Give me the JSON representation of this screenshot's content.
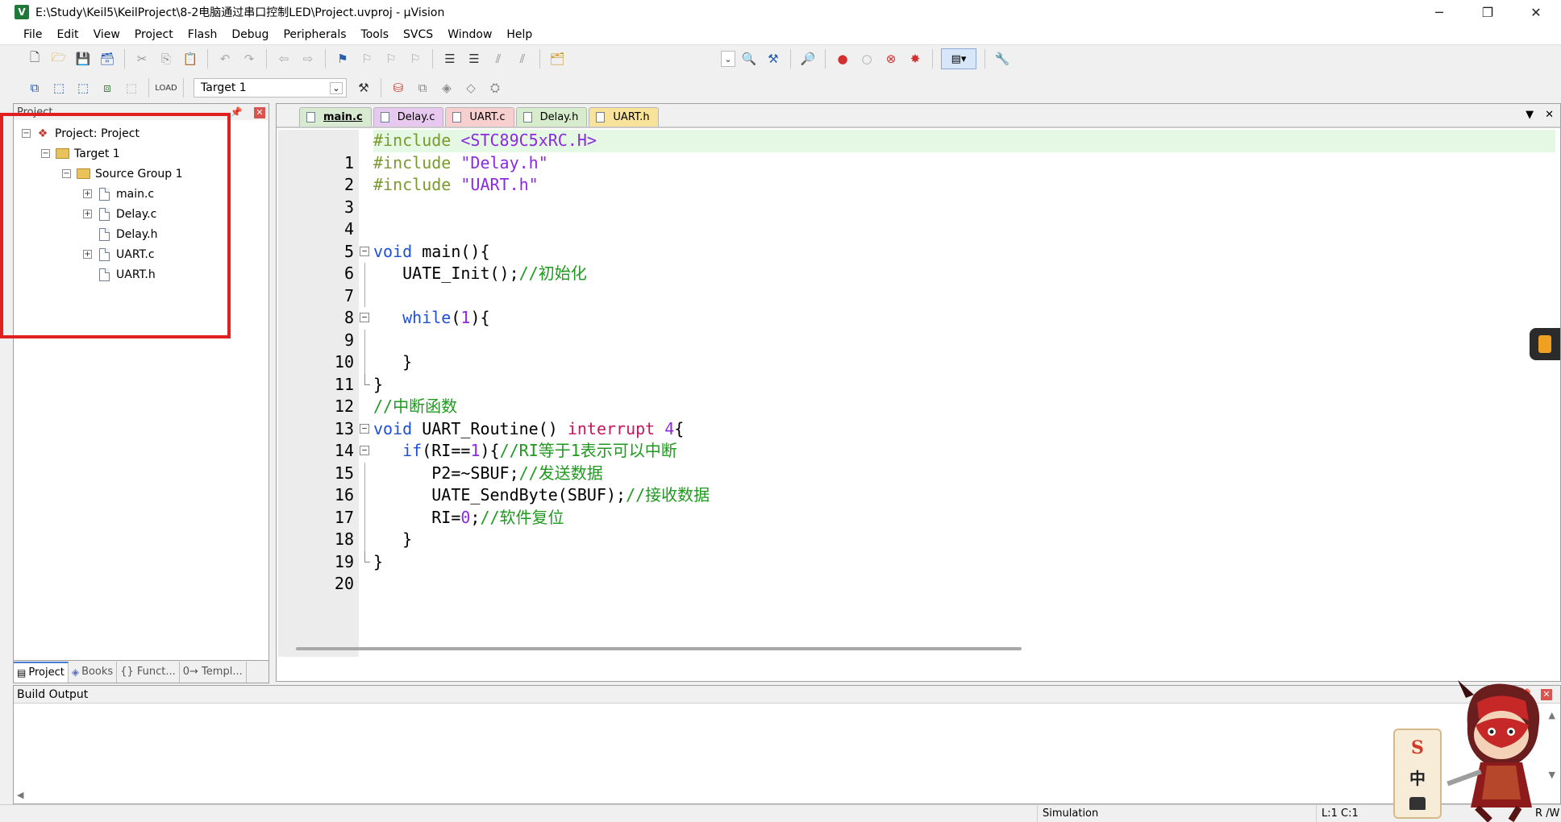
{
  "window": {
    "title": "E:\\Study\\Keil5\\KeilProject\\8-2电脑通过串口控制LED\\Project.uvproj - µVision",
    "app_icon": "V",
    "controls": {
      "minimize": "─",
      "restore": "❐",
      "close": "✕"
    }
  },
  "menu": [
    "File",
    "Edit",
    "View",
    "Project",
    "Flash",
    "Debug",
    "Peripherals",
    "Tools",
    "SVCS",
    "Window",
    "Help"
  ],
  "toolbar": {
    "target_select": "Target 1"
  },
  "project_panel": {
    "header": "Project",
    "tree": {
      "root": "Project: Project",
      "target": "Target 1",
      "group": "Source Group 1",
      "files": [
        "main.c",
        "Delay.c",
        "Delay.h",
        "UART.c",
        "UART.h"
      ]
    },
    "tabs": [
      "Project",
      "Books",
      "{} Funct...",
      "0→ Templ..."
    ]
  },
  "editor": {
    "tabs": [
      {
        "label": "main.c",
        "color": "#d8ead0"
      },
      {
        "label": "Delay.c",
        "color": "#e7c9ef"
      },
      {
        "label": "UART.c",
        "color": "#f7cfcf"
      },
      {
        "label": "Delay.h",
        "color": "#d6eccd"
      },
      {
        "label": "UART.h",
        "color": "#f9e39b"
      }
    ],
    "active_tab": "main.c",
    "line_numbers": [
      "1",
      "2",
      "3",
      "4",
      "5",
      "6",
      "7",
      "8",
      "9",
      "10",
      "11",
      "12",
      "13",
      "14",
      "15",
      "16",
      "17",
      "18",
      "19",
      "20"
    ]
  },
  "build_output": {
    "header": "Build Output"
  },
  "status": {
    "mode": "Simulation",
    "position": "L:1 C:1",
    "rw": "R /W"
  },
  "colors": {
    "highlight_line": "#e4f8e4",
    "preprocessor": "#7a9a2e",
    "string": "#8a2be2",
    "keyword": "#1e4fd8",
    "comment": "#1f9a1f",
    "interrupt": "#c2185b",
    "annotation_box": "#e02020"
  },
  "mascot": {
    "card_top": "S",
    "card_mid": "中"
  }
}
